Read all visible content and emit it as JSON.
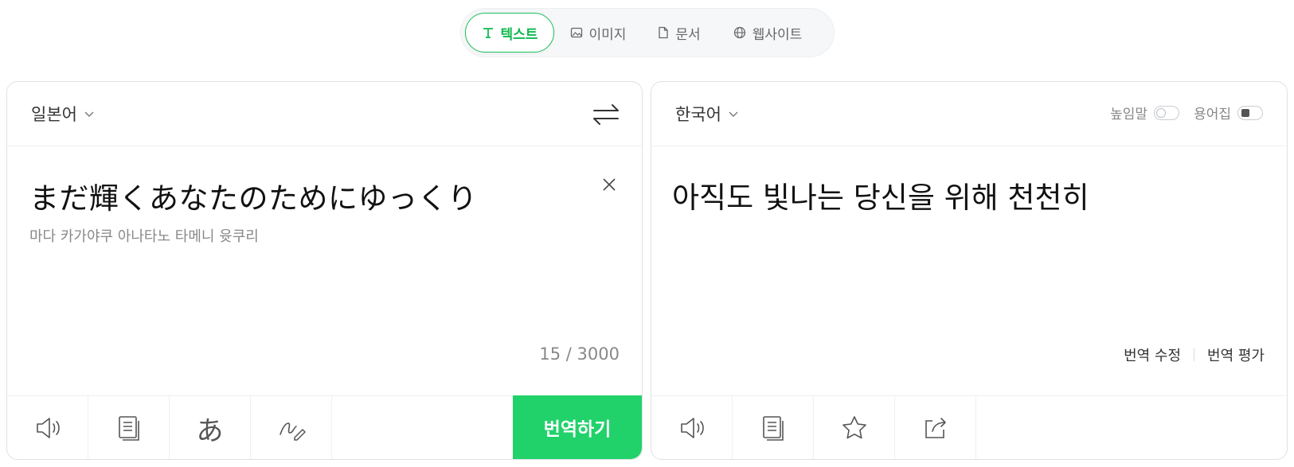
{
  "mode_tabs": [
    {
      "label": "텍스트",
      "icon": "text-icon",
      "active": true
    },
    {
      "label": "이미지",
      "icon": "image-icon",
      "active": false
    },
    {
      "label": "문서",
      "icon": "document-icon",
      "active": false
    },
    {
      "label": "웹사이트",
      "icon": "globe-icon",
      "active": false
    }
  ],
  "source": {
    "language": "일본어",
    "text": "まだ輝くあなたのためにゆっくり",
    "pronunciation": "마다 카가야쿠 아나타노 타메니 윳쿠리",
    "char_count": "15 / 3000",
    "translate_label": "번역하기",
    "tools": [
      "speaker-icon",
      "copy-icon",
      "hiragana-icon",
      "handwriting-icon"
    ],
    "hiragana_glyph": "あ"
  },
  "target": {
    "language": "한국어",
    "honorific_label": "높임말",
    "glossary_label": "용어집",
    "text": "아직도 빛나는 당신을 위해 천천히",
    "edit_label": "번역 수정",
    "rate_label": "번역 평가",
    "tools": [
      "speaker-icon",
      "copy-icon",
      "star-icon",
      "share-icon"
    ]
  },
  "colors": {
    "accent": "#21d26b",
    "active_tab_text": "#0fb94e"
  }
}
